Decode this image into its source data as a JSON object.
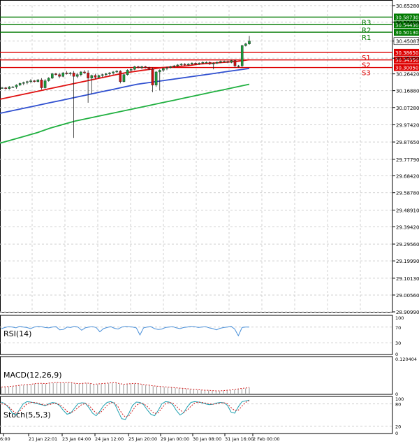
{
  "chart_data": {
    "type": "candlestick",
    "price_axis": {
      "ticks": [
        "30.65280",
        "30.55820",
        "30.45087",
        "30.35350",
        "30.26420",
        "30.16880",
        "30.07280",
        "29.97420",
        "29.87650",
        "29.77790",
        "29.68420",
        "29.58780",
        "29.48910",
        "29.39420",
        "29.29560",
        "29.19990",
        "29.10130",
        "29.00560",
        "28.90990"
      ],
      "ylim": [
        28.9099,
        30.6528
      ]
    },
    "current_price": "30.45087",
    "levels": [
      {
        "label": "R3",
        "value": 30.5873,
        "text": "30.58730",
        "color": "#007a00"
      },
      {
        "label": "R2",
        "value": 30.5443,
        "text": "30.54430",
        "color": "#007a00"
      },
      {
        "label": "R1",
        "value": 30.5013,
        "text": "30.50130",
        "color": "#007a00"
      },
      {
        "label": "S1",
        "value": 30.3865,
        "text": "30.38650",
        "color": "#dd0000"
      },
      {
        "label": "S2",
        "value": 30.3435,
        "text": "30.34350",
        "color": "#dd0000"
      },
      {
        "label": "S3",
        "value": 30.3005,
        "text": "30.30050",
        "color": "#dd0000"
      }
    ],
    "time_axis": [
      "6:00",
      "21 Jan 22:01",
      "23 Jan 04:00",
      "24 Jan 12:00",
      "25 Jan 20:00",
      "29 Jan 00:00",
      "30 Jan 08:00",
      "31 Jan 16:00",
      "2 Feb 00:00"
    ],
    "candles": [
      [
        30.185,
        30.19,
        30.18,
        30.185
      ],
      [
        30.185,
        30.19,
        30.175,
        30.18
      ],
      [
        30.18,
        30.195,
        30.175,
        30.19
      ],
      [
        30.19,
        30.195,
        30.185,
        30.19
      ],
      [
        30.19,
        30.205,
        30.18,
        30.2
      ],
      [
        30.2,
        30.215,
        30.195,
        30.21
      ],
      [
        30.21,
        30.22,
        30.2,
        30.215
      ],
      [
        30.215,
        30.225,
        30.205,
        30.22
      ],
      [
        30.22,
        30.235,
        30.21,
        30.225
      ],
      [
        30.225,
        30.23,
        30.215,
        30.22
      ],
      [
        30.22,
        30.235,
        30.215,
        30.23
      ],
      [
        30.23,
        30.24,
        30.175,
        30.185
      ],
      [
        30.185,
        30.235,
        30.18,
        30.225
      ],
      [
        30.225,
        30.245,
        30.22,
        30.24
      ],
      [
        30.24,
        30.27,
        30.235,
        30.265
      ],
      [
        30.265,
        30.27,
        30.255,
        30.26
      ],
      [
        30.26,
        30.27,
        30.24,
        30.25
      ],
      [
        30.25,
        30.275,
        30.245,
        30.27
      ],
      [
        30.27,
        30.28,
        30.26,
        30.265
      ],
      [
        30.265,
        30.275,
        30.255,
        30.27
      ],
      [
        30.27,
        30.28,
        29.9,
        30.25
      ],
      [
        30.25,
        30.27,
        30.24,
        30.26
      ],
      [
        30.26,
        30.28,
        30.25,
        30.275
      ],
      [
        30.275,
        30.285,
        30.265,
        30.27
      ],
      [
        30.27,
        30.285,
        30.1,
        30.24
      ],
      [
        30.24,
        30.26,
        30.15,
        30.255
      ],
      [
        30.255,
        30.265,
        30.235,
        30.245
      ],
      [
        30.245,
        30.26,
        30.24,
        30.255
      ],
      [
        30.255,
        30.265,
        30.245,
        30.26
      ],
      [
        30.26,
        30.27,
        30.25,
        30.265
      ],
      [
        30.265,
        30.275,
        30.255,
        30.27
      ],
      [
        30.27,
        30.28,
        30.26,
        30.275
      ],
      [
        30.275,
        30.285,
        30.27,
        30.28
      ],
      [
        30.28,
        30.285,
        30.21,
        30.22
      ],
      [
        30.22,
        30.265,
        30.215,
        30.26
      ],
      [
        30.26,
        30.29,
        30.255,
        30.285
      ],
      [
        30.285,
        30.3,
        30.275,
        30.29
      ],
      [
        30.29,
        30.31,
        30.285,
        30.305
      ],
      [
        30.305,
        30.31,
        30.295,
        30.3
      ],
      [
        30.3,
        30.31,
        30.29,
        30.305
      ],
      [
        30.305,
        30.31,
        30.295,
        30.3
      ],
      [
        30.3,
        30.305,
        30.285,
        30.29
      ],
      [
        30.29,
        30.3,
        30.16,
        30.2
      ],
      [
        30.2,
        30.28,
        30.19,
        30.275
      ],
      [
        30.275,
        30.29,
        30.17,
        30.285
      ],
      [
        30.285,
        30.3,
        30.275,
        30.295
      ],
      [
        30.295,
        30.305,
        30.285,
        30.3
      ],
      [
        30.3,
        30.31,
        30.295,
        30.305
      ],
      [
        30.305,
        30.315,
        30.3,
        30.31
      ],
      [
        30.31,
        30.32,
        30.305,
        30.315
      ],
      [
        30.315,
        30.325,
        30.31,
        30.32
      ],
      [
        30.32,
        30.325,
        30.31,
        30.315
      ],
      [
        30.315,
        30.325,
        30.31,
        30.32
      ],
      [
        30.32,
        30.33,
        30.315,
        30.325
      ],
      [
        30.325,
        30.33,
        30.315,
        30.32
      ],
      [
        30.32,
        30.33,
        30.315,
        30.325
      ],
      [
        30.325,
        30.335,
        30.32,
        30.33
      ],
      [
        30.33,
        30.335,
        30.325,
        30.33
      ],
      [
        30.33,
        30.335,
        30.315,
        30.32
      ],
      [
        30.32,
        30.33,
        30.29,
        30.325
      ],
      [
        30.325,
        30.335,
        30.32,
        30.33
      ],
      [
        30.33,
        30.34,
        30.325,
        30.335
      ],
      [
        30.335,
        30.34,
        30.33,
        30.335
      ],
      [
        30.335,
        30.34,
        30.325,
        30.33
      ],
      [
        30.33,
        30.345,
        30.325,
        30.34
      ],
      [
        30.34,
        30.345,
        30.3,
        30.31
      ],
      [
        30.31,
        30.315,
        30.3,
        30.31
      ],
      [
        30.31,
        30.43,
        30.3,
        30.425
      ],
      [
        30.425,
        30.44,
        30.42,
        30.435
      ],
      [
        30.435,
        30.48,
        30.43,
        30.45087
      ]
    ],
    "ma_lines": [
      {
        "color": "#e01010",
        "values": [
          30.12,
          30.135,
          30.15,
          30.165,
          30.18,
          30.195,
          30.21,
          30.225,
          30.24,
          30.255,
          30.27,
          30.28,
          30.29,
          30.3,
          30.305,
          30.31,
          30.32,
          30.325,
          30.33,
          30.335,
          30.345
        ]
      },
      {
        "color": "#3050d0",
        "values": [
          30.04,
          30.055,
          30.07,
          30.085,
          30.1,
          30.115,
          30.13,
          30.145,
          30.16,
          30.175,
          30.19,
          30.205,
          30.215,
          30.225,
          30.235,
          30.245,
          30.255,
          30.265,
          30.275,
          30.285,
          30.295
        ]
      },
      {
        "color": "#20b040",
        "values": [
          29.87,
          29.89,
          29.91,
          29.93,
          29.955,
          29.975,
          29.995,
          30.01,
          30.025,
          30.04,
          30.055,
          30.07,
          30.085,
          30.1,
          30.115,
          30.13,
          30.145,
          30.16,
          30.175,
          30.19,
          30.205
        ]
      }
    ],
    "indicators": [
      {
        "name": "RSI(14)",
        "ticks": [
          "100",
          "70",
          "30",
          "0"
        ],
        "ylim": [
          0,
          100
        ],
        "color": "#4a90d9",
        "values": [
          66,
          69,
          71,
          70,
          68,
          72,
          70,
          69,
          66,
          70,
          72,
          71,
          69,
          68,
          70,
          71,
          63,
          64,
          70,
          69,
          72,
          70,
          62,
          68,
          70,
          71,
          69,
          58,
          66,
          69,
          71,
          67,
          65,
          70,
          72,
          71,
          70,
          68,
          50,
          68,
          70,
          71,
          66,
          64,
          65,
          69,
          70,
          71,
          68,
          66,
          69,
          70,
          72,
          71,
          69,
          70,
          71,
          68,
          66,
          63,
          67,
          69,
          70,
          72,
          65,
          48,
          69,
          70,
          70
        ]
      },
      {
        "name": "MACD(12,26,9)",
        "ticks": [
          "0.120404",
          "0"
        ],
        "ylim": [
          0,
          0.120404
        ],
        "values": [
          0.022,
          0.023,
          0.024,
          0.025,
          0.026,
          0.028,
          0.029,
          0.03,
          0.031,
          0.033,
          0.034,
          0.034,
          0.033,
          0.035,
          0.036,
          0.037,
          0.036,
          0.036,
          0.037,
          0.036,
          0.034,
          0.033,
          0.034,
          0.035,
          0.034,
          0.031,
          0.032,
          0.033,
          0.034,
          0.035,
          0.036,
          0.036,
          0.033,
          0.031,
          0.032,
          0.033,
          0.034,
          0.033,
          0.031,
          0.029,
          0.028,
          0.026,
          0.025,
          0.024,
          0.023,
          0.022,
          0.021,
          0.02,
          0.019,
          0.018,
          0.017,
          0.016,
          0.015,
          0.014,
          0.013,
          0.012,
          0.012,
          0.011,
          0.01,
          0.01,
          0.011,
          0.012,
          0.013,
          0.014,
          0.016,
          0.018,
          0.019,
          0.021
        ]
      },
      {
        "name": "Stoch(5,5,3)",
        "ticks": [
          "100",
          "80",
          "20",
          "0"
        ],
        "ylim": [
          0,
          100
        ],
        "k_values": [
          85,
          80,
          70,
          55,
          50,
          65,
          80,
          86,
          85,
          83,
          80,
          78,
          75,
          80,
          84,
          82,
          75,
          62,
          52,
          55,
          68,
          80,
          83,
          82,
          70,
          55,
          48,
          60,
          75,
          84,
          86,
          82,
          60,
          40,
          38,
          55,
          76,
          85,
          84,
          78,
          64,
          52,
          48,
          62,
          80,
          86,
          85,
          78,
          62,
          50,
          56,
          72,
          84,
          86,
          85,
          83,
          80,
          78,
          79,
          82,
          84,
          83,
          76,
          58,
          55,
          72,
          86,
          88,
          90
        ],
        "d_values": [
          80,
          79,
          73,
          62,
          55,
          60,
          70,
          80,
          84,
          84,
          82,
          79,
          77,
          78,
          80,
          81,
          78,
          70,
          60,
          56,
          61,
          70,
          78,
          81,
          76,
          65,
          55,
          55,
          65,
          76,
          83,
          83,
          72,
          55,
          44,
          48,
          62,
          76,
          82,
          81,
          73,
          62,
          54,
          56,
          68,
          80,
          84,
          82,
          74,
          63,
          57,
          63,
          74,
          82,
          85,
          84,
          82,
          80,
          79,
          80,
          82,
          83,
          80,
          70,
          62,
          63,
          74,
          84,
          89
        ]
      }
    ]
  }
}
